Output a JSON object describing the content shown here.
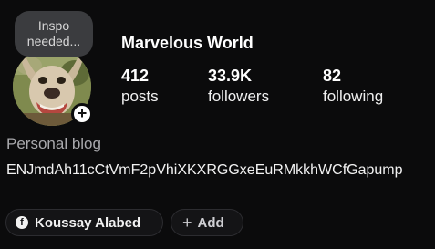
{
  "profile": {
    "note": "Inspo needed...",
    "display_name": "Marvelous World",
    "add_story_icon": "plus-icon"
  },
  "stats": {
    "posts": {
      "value": "412",
      "label": "posts"
    },
    "followers": {
      "value": "33.9K",
      "label": "followers"
    },
    "following": {
      "value": "82",
      "label": "following"
    }
  },
  "bio": {
    "category": "Personal blog",
    "text": "ENJmdAh11cCtVmF2pVhiXKXRGGxeEuRMkkhWCfGapump"
  },
  "links": {
    "facebook": {
      "icon": "facebook-icon",
      "label": "Koussay Alabed"
    },
    "add": {
      "icon": "plus-icon",
      "label": "Add"
    }
  },
  "colors": {
    "background": "#0b0b0c",
    "chip_background": "#141416",
    "note_bubble": "#3b3c3f",
    "muted_text": "#a9a9ad"
  }
}
